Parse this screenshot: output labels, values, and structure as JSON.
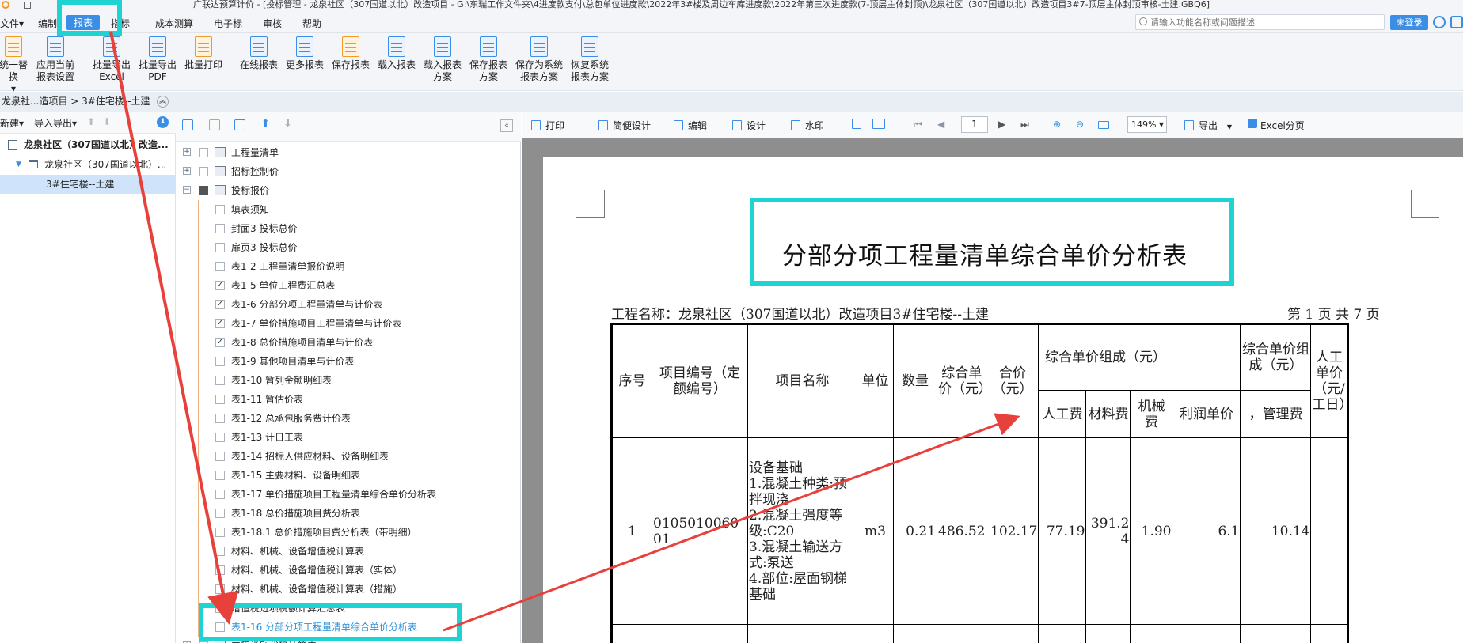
{
  "title": "广联达预算计价 - [投标管理 - 龙泉社区（307国道以北）改造项目 - G:\\东瑞工作文件夹\\4进度款支付\\总包单位进度款\\2022年3#楼及周边车库进度款\\2022年第三次进度款(7-顶层主体封顶)\\龙泉社区（307国道以北）改造项目3#7-顶层主体封顶审核-土建.GBQ6]",
  "menu": [
    "文件▾",
    "编制",
    "报表",
    "指标",
    "成本测算",
    "电子标",
    "审核",
    "帮助"
  ],
  "search_placeholder": "请输入功能名称或问题描述",
  "login_label": "未登录",
  "toolbar": [
    {
      "l1": "统一替换",
      "l2": "▾"
    },
    {
      "l1": "应用当前",
      "l2": "报表设置"
    },
    {
      "l1": "批量导出",
      "l2": "Excel"
    },
    {
      "l1": "批量导出",
      "l2": "PDF"
    },
    {
      "l1": "批量打印",
      "l2": ""
    },
    {
      "l1": "在线报表",
      "l2": ""
    },
    {
      "l1": "更多报表",
      "l2": ""
    },
    {
      "l1": "保存报表",
      "l2": ""
    },
    {
      "l1": "载入报表",
      "l2": ""
    },
    {
      "l1": "载入报表",
      "l2": "方案"
    },
    {
      "l1": "保存报表",
      "l2": "方案"
    },
    {
      "l1": "保存为系统",
      "l2": "报表方案"
    },
    {
      "l1": "恢复系统",
      "l2": "报表方案"
    }
  ],
  "breadcrumb": "龙泉社...造项目 > 3#住宅楼--土建",
  "left_tools": {
    "new": "新建▾",
    "import_export": "导入导出▾"
  },
  "project_tree": [
    "龙泉社区（307国道以北）改造...",
    "龙泉社区（307国道以北）...",
    "3#住宅楼--土建"
  ],
  "report_tree": [
    {
      "label": "工程量清单",
      "level": 0,
      "checked": false
    },
    {
      "label": "招标控制价",
      "level": 0,
      "checked": false
    },
    {
      "label": "投标报价",
      "level": 0,
      "checked": "partial"
    },
    {
      "label": "填表须知",
      "level": 1,
      "checked": false
    },
    {
      "label": "封面3 投标总价",
      "level": 1,
      "checked": false
    },
    {
      "label": "扉页3 投标总价",
      "level": 1,
      "checked": false
    },
    {
      "label": "表1-2 工程量清单报价说明",
      "level": 1,
      "checked": false
    },
    {
      "label": "表1-5 单位工程费汇总表",
      "level": 1,
      "checked": true
    },
    {
      "label": "表1-6 分部分项工程量清单与计价表",
      "level": 1,
      "checked": true
    },
    {
      "label": "表1-7 单价措施项目工程量清单与计价表",
      "level": 1,
      "checked": true
    },
    {
      "label": "表1-8 总价措施项目清单与计价表",
      "level": 1,
      "checked": true
    },
    {
      "label": "表1-9 其他项目清单与计价表",
      "level": 1,
      "checked": false
    },
    {
      "label": "表1-10 暂列金额明细表",
      "level": 1,
      "checked": false
    },
    {
      "label": "表1-11 暂估价表",
      "level": 1,
      "checked": false
    },
    {
      "label": "表1-12 总承包服务费计价表",
      "level": 1,
      "checked": false
    },
    {
      "label": "表1-13 计日工表",
      "level": 1,
      "checked": false
    },
    {
      "label": "表1-14 招标人供应材料、设备明细表",
      "level": 1,
      "checked": false
    },
    {
      "label": "表1-15 主要材料、设备明细表",
      "level": 1,
      "checked": false
    },
    {
      "label": "表1-17 单价措施项目工程量清单综合单价分析表",
      "level": 1,
      "checked": false
    },
    {
      "label": "表1-18 总价措施项目费分析表",
      "level": 1,
      "checked": false
    },
    {
      "label": "表1-18.1 总价措施项目费分析表（带明细）",
      "level": 1,
      "checked": false
    },
    {
      "label": "材料、机械、设备增值税计算表",
      "level": 1,
      "checked": false
    },
    {
      "label": "材料、机械、设备增值税计算表（实体）",
      "level": 1,
      "checked": false
    },
    {
      "label": "材料、机械、设备增值税计算表（措施）",
      "level": 1,
      "checked": false
    },
    {
      "label": "增值税进项税额计算汇总表",
      "level": 1,
      "checked": false
    },
    {
      "label": "表1-16 分部分项工程量清单综合单价分析表",
      "level": 1,
      "checked": false,
      "highlight": true
    },
    {
      "label": "工程类别代码计算表",
      "level": 0,
      "checked": false
    }
  ],
  "view_tools": {
    "print": "打印",
    "quick_design": "简便设计",
    "edit": "编辑",
    "design": "设计",
    "watermark": "水印",
    "page": "1",
    "zoom": "149%",
    "export": "导出",
    "excel_pages": "Excel分页"
  },
  "report": {
    "title": "分部分项工程量清单综合单价分析表",
    "project_label": "工程名称：龙泉社区（307国道以北）改造项目3#住宅楼--土建",
    "page_info": "第 1 页  共 7 页",
    "headers": {
      "seq": "序号",
      "code": "项目编号（定额编号）",
      "name": "项目名称",
      "unit": "单位",
      "qty": "数量",
      "unit_price": "综合单价（元）",
      "total": "合价（元）",
      "composition": "综合单价组成（元）",
      "labor": "人工费",
      "material": "材料费",
      "machine": "机械费",
      "profit": "利润单价",
      "composition2": "综合单价组成（元）",
      "mgmt": "，管理费",
      "labor_day": "人工单价（元/工日）"
    },
    "row1": {
      "seq": "1",
      "code": "010501006001",
      "name_lines": "设备基础\n1.混凝土种类:预拌现浇\n2.混凝土强度等级:C20\n3.混凝土输送方式:泵送\n4.部位:屋面钢梯基础",
      "unit": "m3",
      "qty": "0.21",
      "unit_price": "486.52",
      "total": "102.17",
      "labor": "77.19",
      "material": "391.24",
      "machine": "1.90",
      "profit": "6.1",
      "mgmt": "10.14"
    }
  },
  "colors": {
    "accent": "#3a8ee6",
    "highlight_box": "#1fd3d3",
    "arrow": "#e8403a"
  }
}
